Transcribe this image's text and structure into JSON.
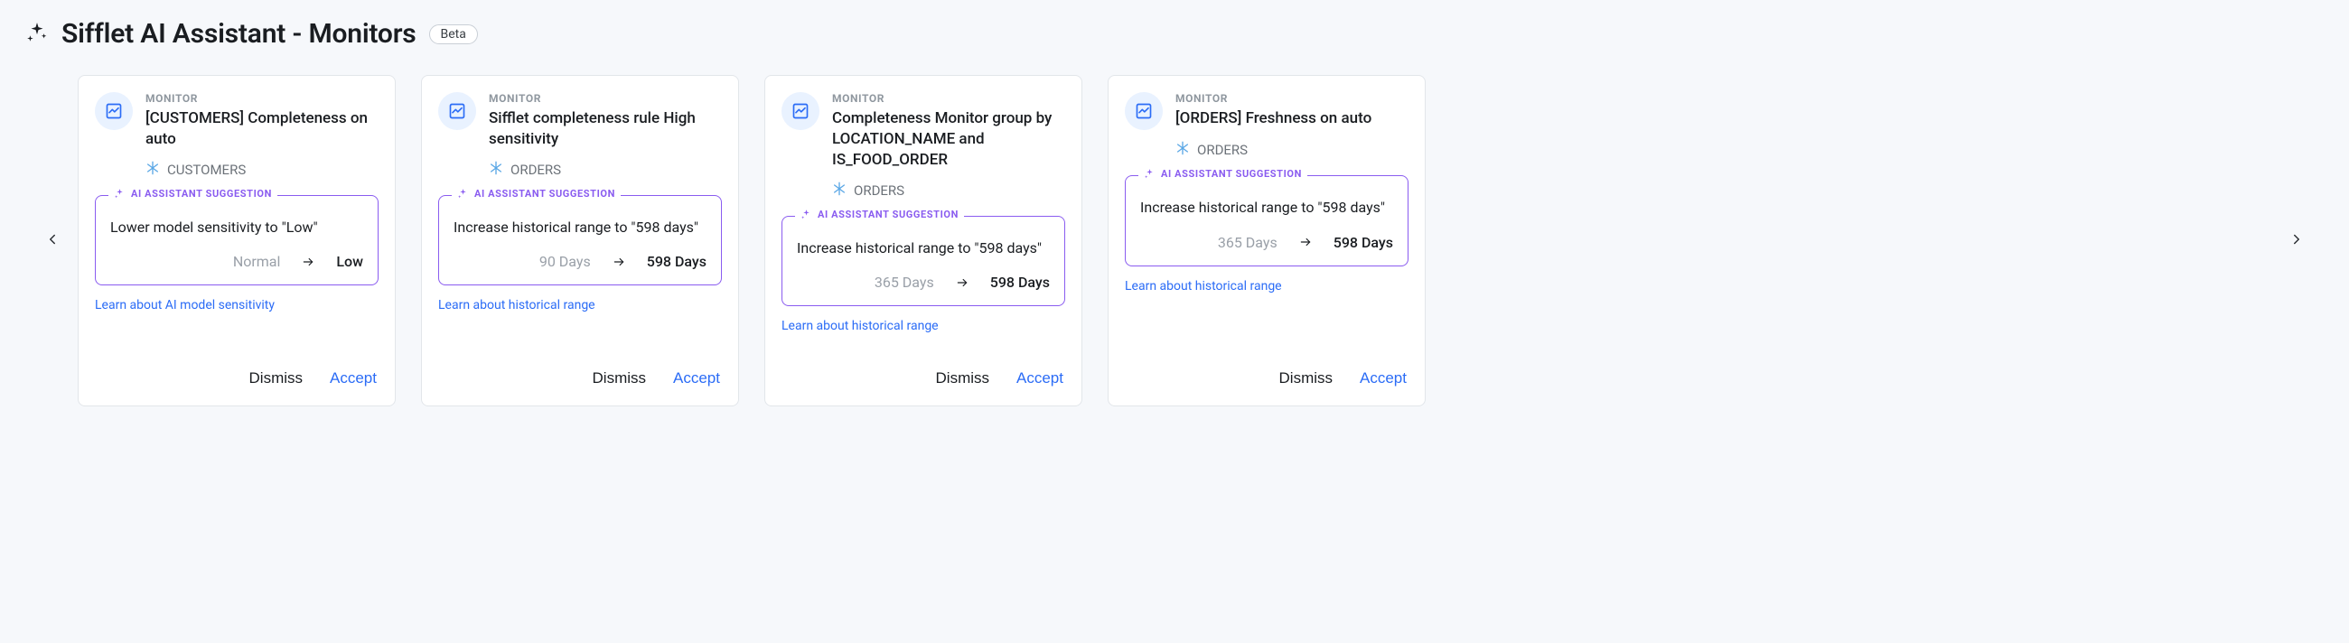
{
  "header": {
    "title": "Sifflet AI Assistant - Monitors",
    "badge": "Beta"
  },
  "suggestion_label": "AI ASSISTANT SUGGESTION",
  "actions": {
    "dismiss": "Dismiss",
    "accept": "Accept"
  },
  "cards": [
    {
      "kicker": "MONITOR",
      "title": "[CUSTOMERS] Completeness on auto",
      "dataset": "CUSTOMERS",
      "suggestion_text": "Lower model sensitivity to \"Low\"",
      "from_value": "Normal",
      "to_value": "Low",
      "learn": "Learn about AI model sensitivity"
    },
    {
      "kicker": "MONITOR",
      "title": "Sifflet completeness rule High sensitivity",
      "dataset": "ORDERS",
      "suggestion_text": "Increase historical range to \"598 days\"",
      "from_value": "90 Days",
      "to_value": "598 Days",
      "learn": "Learn about historical range"
    },
    {
      "kicker": "MONITOR",
      "title": "Completeness Monitor group by LOCATION_NAME and IS_FOOD_ORDER",
      "dataset": "ORDERS",
      "suggestion_text": "Increase historical range to \"598 days\"",
      "from_value": "365 Days",
      "to_value": "598 Days",
      "learn": "Learn about historical range"
    },
    {
      "kicker": "MONITOR",
      "title": "[ORDERS] Freshness on auto",
      "dataset": "ORDERS",
      "suggestion_text": "Increase historical range to \"598 days\"",
      "from_value": "365 Days",
      "to_value": "598 Days",
      "learn": "Learn about historical range"
    }
  ]
}
